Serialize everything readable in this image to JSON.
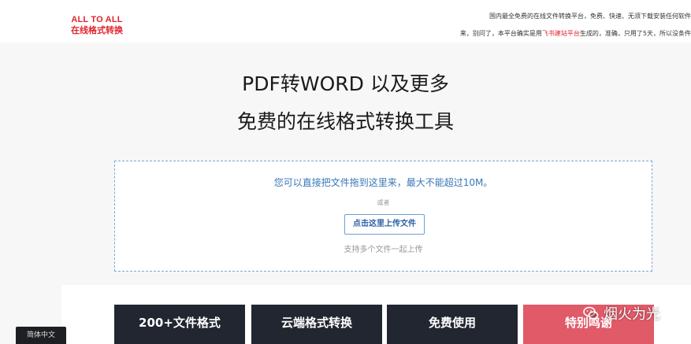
{
  "header": {
    "logo_line1": "ALL TO ALL",
    "logo_line2": "在线格式转换",
    "ticker_line1": "国内最全免费的在线文件转换平台，免费、快速、无须下载安装任何软件",
    "ticker_line2_a": "来，别问了，本平台确实是用",
    "ticker_line2_hl": "飞书建站平台",
    "ticker_line2_b": "生成的，准确，只用了5天，所以没条件的"
  },
  "hero": {
    "headline1": "PDF转WORD 以及更多",
    "headline2": "免费的在线格式转换工具"
  },
  "upload": {
    "hint": "您可以直接把文件拖到这里来，最大不能超过10M。",
    "or": "或者",
    "button": "点击这里上传文件",
    "subtext": "支持多个文件一起上传"
  },
  "features": [
    {
      "label": "200+文件格式"
    },
    {
      "label": "云端格式转换"
    },
    {
      "label": "免费使用"
    },
    {
      "label": "特别鸣谢"
    }
  ],
  "watermark": {
    "text": "烟火为光",
    "icon": "wechat-icon"
  },
  "language": {
    "label": "简体中文"
  },
  "colors": {
    "brand": "#e0242d",
    "link": "#3877b8",
    "card": "#212630",
    "card_accent": "#e05a68"
  }
}
